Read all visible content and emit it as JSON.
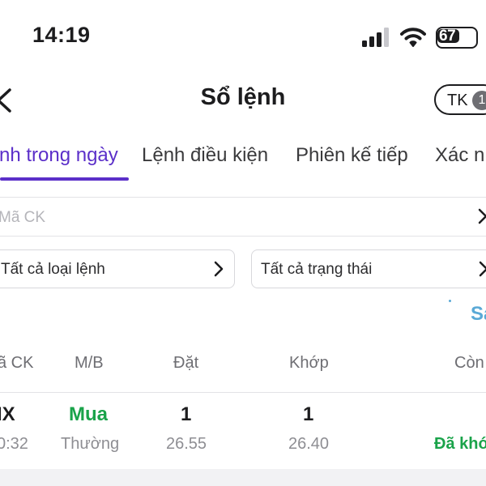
{
  "status_bar": {
    "time": "14:19",
    "battery": "67",
    "battery_level": 0.67
  },
  "header": {
    "back_icon": "chevron-left-icon",
    "title": "Sổ lệnh",
    "account_label": "TK",
    "account_number": "1"
  },
  "tabs": [
    {
      "label": "nh trong ngày",
      "active": true
    },
    {
      "label": "Lệnh điều kiện",
      "active": false
    },
    {
      "label": "Phiên kế tiếp",
      "active": false
    },
    {
      "label": "Xác nh",
      "active": false
    }
  ],
  "search": {
    "placeholder": "Mã CK"
  },
  "filters": {
    "order_type": "Tất cả loại lệnh",
    "status": "Tất cả trạng thái"
  },
  "action_link": "Sa",
  "table": {
    "headers": [
      "ã CK",
      "M/B",
      "Đặt",
      "Khớp",
      "Còn"
    ],
    "rows": [
      {
        "symbol": "IX",
        "time": "0:32",
        "side": "Mua",
        "type": "Thường",
        "order_qty": "1",
        "order_price": "26.55",
        "match_qty": "1",
        "match_price": "26.40",
        "status": "Đã khớ"
      }
    ]
  },
  "colors": {
    "accent": "#5b2fc9",
    "buy": "#1aa34a",
    "link": "#5aa9d6"
  }
}
